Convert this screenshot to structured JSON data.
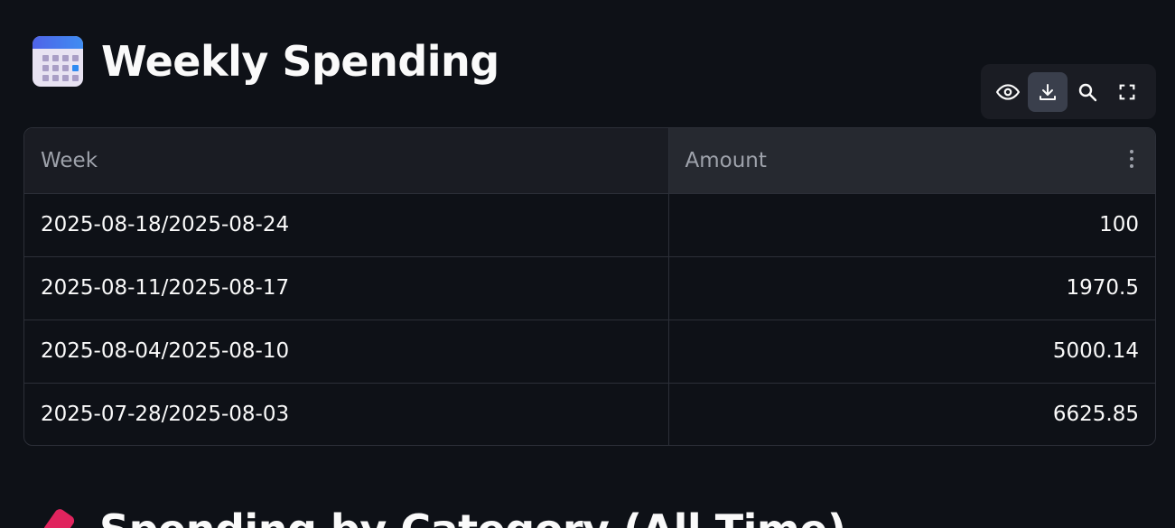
{
  "section1": {
    "title": "Weekly Spending",
    "icon": "calendar-icon"
  },
  "toolbar": {
    "buttons": [
      {
        "name": "show-hide-columns",
        "icon": "eye-icon"
      },
      {
        "name": "download-csv",
        "icon": "download-icon",
        "active": true
      },
      {
        "name": "search",
        "icon": "search-icon"
      },
      {
        "name": "fullscreen",
        "icon": "fullscreen-icon"
      }
    ]
  },
  "table": {
    "columns": [
      "Week",
      "Amount"
    ],
    "rows": [
      {
        "week": "2025-08-18/2025-08-24",
        "amount": "100"
      },
      {
        "week": "2025-08-11/2025-08-17",
        "amount": "1970.5"
      },
      {
        "week": "2025-08-04/2025-08-10",
        "amount": "5000.14"
      },
      {
        "week": "2025-07-28/2025-08-03",
        "amount": "6625.85"
      }
    ]
  },
  "section2": {
    "title": "Spending by Category (All Time)",
    "icon": "pushpin-icon"
  },
  "colors": {
    "background": "#0e1117",
    "header_bg": "#1a1c23",
    "border": "#2c2f38",
    "text": "#fafafa",
    "muted_text": "#9ea2ab"
  }
}
